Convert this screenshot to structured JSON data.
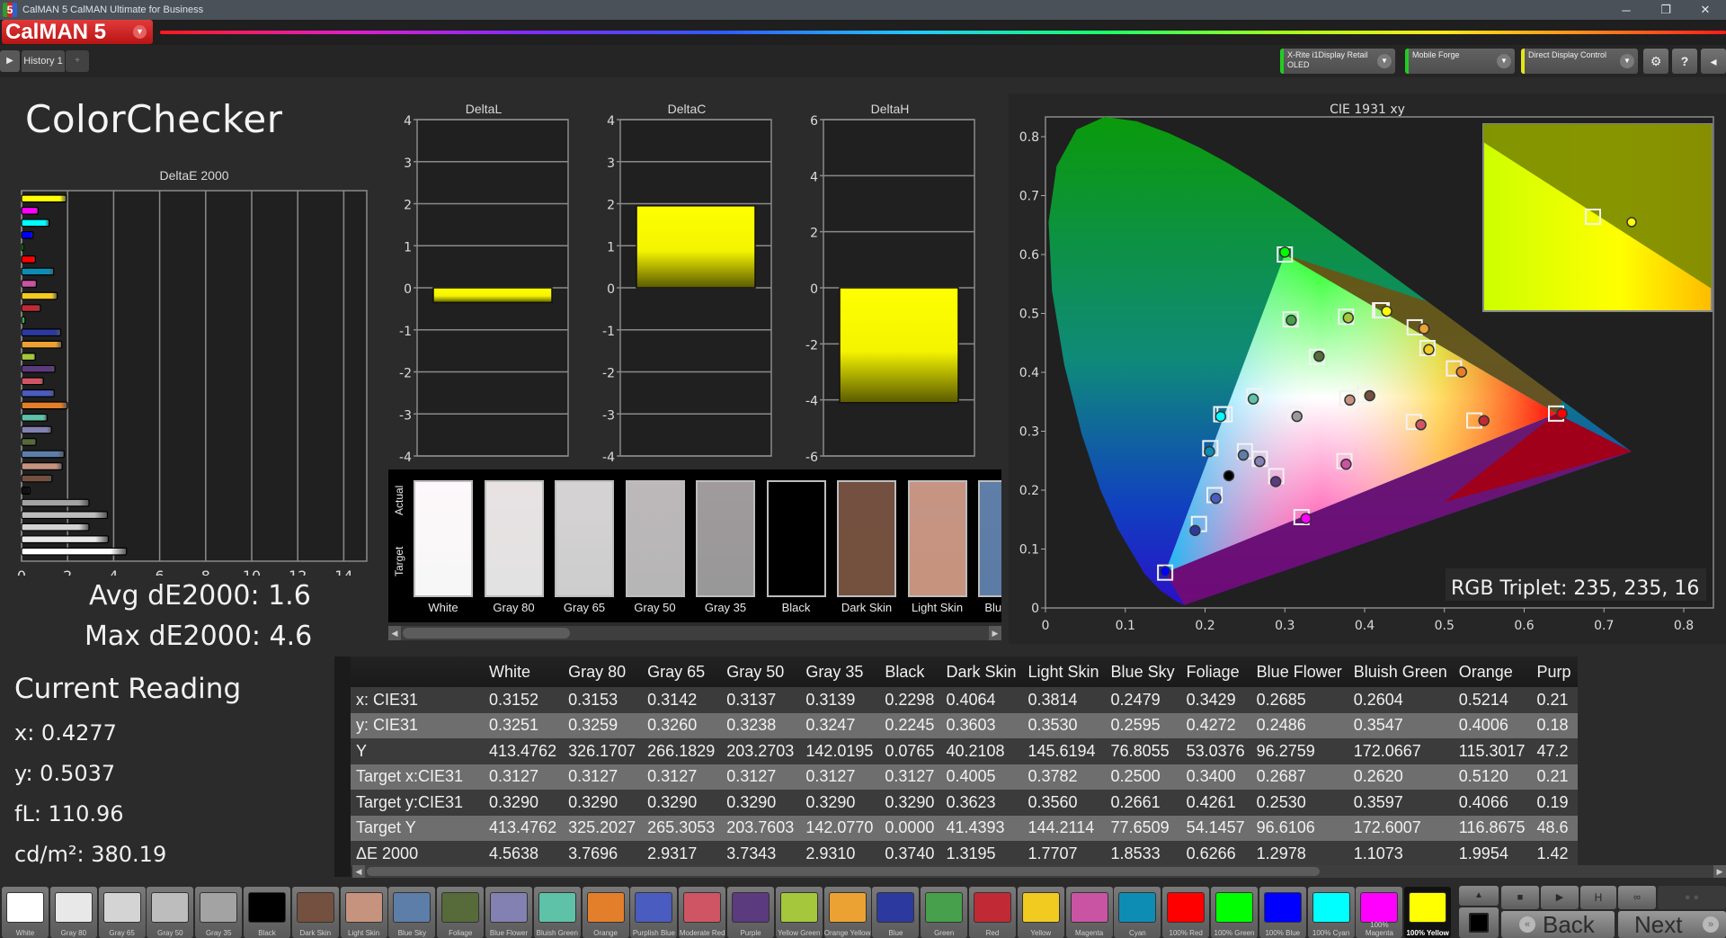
{
  "window": {
    "title": "CalMAN 5 CalMAN Ultimate for Business",
    "app_icon": "5",
    "controls": [
      "minimize-icon",
      "restore-icon",
      "close-icon"
    ]
  },
  "brand": {
    "label": "CalMAN 5",
    "dropdown_icon": "chevron-down-icon"
  },
  "toolbar": {
    "play_icon": "play-icon",
    "history_tab": "History 1",
    "add_tab_icon": "plus-icon",
    "devices": [
      {
        "line1": "X-Rite i1Display Retail",
        "line2": "OLED",
        "status_color": "#22cc22"
      },
      {
        "line1": "Mobile Forge",
        "line2": "",
        "status_color": "#22cc22"
      },
      {
        "line1": "Direct Display Control",
        "line2": "",
        "status_color": "#e5e51a"
      }
    ],
    "buttons": [
      {
        "icon": "gear-icon",
        "glyph": "⚙"
      },
      {
        "icon": "help-icon",
        "glyph": "?"
      },
      {
        "icon": "collapse-icon",
        "glyph": "◂"
      }
    ]
  },
  "page": {
    "title": "ColorChecker"
  },
  "summary": {
    "avg": "Avg dE2000: 1.6",
    "max": "Max dE2000: 4.6"
  },
  "current_reading": {
    "title": "Current Reading",
    "x": "x: 0.4277",
    "y": "y: 0.5037",
    "fl": "fL: 110.96",
    "cdm2": "cd/m²: 380.19"
  },
  "swatch_strip": {
    "actual_label": "Actual",
    "target_label": "Target",
    "items": [
      {
        "name": "White",
        "actual": "#fdf8fb",
        "target": "#f7f7f7"
      },
      {
        "name": "Gray 80",
        "actual": "#e8e2e3",
        "target": "#e2e2e2"
      },
      {
        "name": "Gray 65",
        "actual": "#d6d3d4",
        "target": "#cdcdcd"
      },
      {
        "name": "Gray 50",
        "actual": "#bdb8ba",
        "target": "#b6b6b6"
      },
      {
        "name": "Gray 35",
        "actual": "#a09a9c",
        "target": "#989898"
      },
      {
        "name": "Black",
        "actual": "#000000",
        "target": "#000000"
      },
      {
        "name": "Dark Skin",
        "actual": "#73503f",
        "target": "#74503f"
      },
      {
        "name": "Light Skin",
        "actual": "#c79483",
        "target": "#c5937e"
      },
      {
        "name": "Blue Sky",
        "actual": "#5f7ea8",
        "target": "#5b7ca6"
      }
    ]
  },
  "table": {
    "columns": [
      "White",
      "Gray 80",
      "Gray 65",
      "Gray 50",
      "Gray 35",
      "Black",
      "Dark Skin",
      "Light Skin",
      "Blue Sky",
      "Foliage",
      "Blue Flower",
      "Bluish Green",
      "Orange",
      "Purp"
    ],
    "rows": [
      {
        "label": "x: CIE31",
        "values": [
          "0.3152",
          "0.3153",
          "0.3142",
          "0.3137",
          "0.3139",
          "0.2298",
          "0.4064",
          "0.3814",
          "0.2479",
          "0.3429",
          "0.2685",
          "0.2604",
          "0.5214",
          "0.21"
        ]
      },
      {
        "label": "y: CIE31",
        "values": [
          "0.3251",
          "0.3259",
          "0.3260",
          "0.3238",
          "0.3247",
          "0.2245",
          "0.3603",
          "0.3530",
          "0.2595",
          "0.4272",
          "0.2486",
          "0.3547",
          "0.4006",
          "0.18"
        ]
      },
      {
        "label": "Y",
        "values": [
          "413.4762",
          "326.1707",
          "266.1829",
          "203.2703",
          "142.0195",
          "0.0765",
          "40.2108",
          "145.6194",
          "76.8055",
          "53.0376",
          "96.2759",
          "172.0667",
          "115.3017",
          "47.2"
        ]
      },
      {
        "label": "Target x:CIE31",
        "values": [
          "0.3127",
          "0.3127",
          "0.3127",
          "0.3127",
          "0.3127",
          "0.3127",
          "0.4005",
          "0.3782",
          "0.2500",
          "0.3400",
          "0.2687",
          "0.2620",
          "0.5120",
          "0.21"
        ]
      },
      {
        "label": "Target y:CIE31",
        "values": [
          "0.3290",
          "0.3290",
          "0.3290",
          "0.3290",
          "0.3290",
          "0.3290",
          "0.3623",
          "0.3560",
          "0.2661",
          "0.4261",
          "0.2530",
          "0.3597",
          "0.4066",
          "0.19"
        ]
      },
      {
        "label": "Target Y",
        "values": [
          "413.4762",
          "325.2027",
          "265.3053",
          "203.7603",
          "142.0770",
          "0.0000",
          "41.4393",
          "144.2114",
          "77.6509",
          "54.1457",
          "96.6106",
          "172.6007",
          "116.8675",
          "48.6"
        ]
      },
      {
        "label": "ΔE 2000",
        "values": [
          "4.5638",
          "3.7696",
          "2.9317",
          "3.7343",
          "2.9310",
          "0.3740",
          "1.3195",
          "1.7707",
          "1.8533",
          "0.6266",
          "1.2978",
          "1.1073",
          "1.9954",
          "1.42"
        ]
      }
    ]
  },
  "patches": [
    {
      "label": "White",
      "color": "#ffffff"
    },
    {
      "label": "Gray 80",
      "color": "#e8e8e8"
    },
    {
      "label": "Gray 65",
      "color": "#d4d4d4"
    },
    {
      "label": "Gray 50",
      "color": "#bdbdbd"
    },
    {
      "label": "Gray 35",
      "color": "#a3a3a3"
    },
    {
      "label": "Black",
      "color": "#000000"
    },
    {
      "label": "Dark Skin",
      "color": "#73503f"
    },
    {
      "label": "Light Skin",
      "color": "#c6937f"
    },
    {
      "label": "Blue Sky",
      "color": "#5c7ea8"
    },
    {
      "label": "Foliage",
      "color": "#566a3a"
    },
    {
      "label": "Blue Flower",
      "color": "#8381b2"
    },
    {
      "label": "Bluish Green",
      "color": "#5ec2a8"
    },
    {
      "label": "Orange",
      "color": "#e37f2a"
    },
    {
      "label": "Purplish Blue",
      "color": "#4a5cc0"
    },
    {
      "label": "Moderate Red",
      "color": "#d05564"
    },
    {
      "label": "Purple",
      "color": "#5b3a7e"
    },
    {
      "label": "Yellow Green",
      "color": "#a5c73c"
    },
    {
      "label": "Orange Yellow",
      "color": "#eca232"
    },
    {
      "label": "Blue",
      "color": "#2c3aa0"
    },
    {
      "label": "Green",
      "color": "#47a04b"
    },
    {
      "label": "Red",
      "color": "#c12a35"
    },
    {
      "label": "Yellow",
      "color": "#f1cb1f"
    },
    {
      "label": "Magenta",
      "color": "#c954a4"
    },
    {
      "label": "Cyan",
      "color": "#0e8db4"
    },
    {
      "label": "100% Red",
      "color": "#ff0000"
    },
    {
      "label": "100% Green",
      "color": "#00ff00"
    },
    {
      "label": "100% Blue",
      "color": "#0000ff"
    },
    {
      "label": "100% Cyan",
      "color": "#00ffff"
    },
    {
      "label": "100% Magenta",
      "color": "#ff00ff"
    },
    {
      "label": "100% Yellow",
      "color": "#ffff00",
      "selected": true
    }
  ],
  "controls": {
    "up_icon": "eject-icon",
    "stop_small_icon": "stop-icon",
    "stop_icon": "stop-square-icon",
    "play_icon": "play-icon",
    "hold_icon": "hold-icon",
    "loop_icon": "loop-icon",
    "back_label": "Back",
    "next_label": "Next"
  },
  "cie": {
    "rgb_triplet": "RGB Triplet: 235, 235, 16"
  },
  "chart_data": [
    {
      "type": "bar",
      "orientation": "horizontal",
      "title": "DeltaE 2000",
      "xlim": [
        0,
        15
      ],
      "xticks": [
        0,
        2,
        4,
        6,
        8,
        10,
        12,
        14
      ],
      "grid": true,
      "categories": [
        "White",
        "Gray 80",
        "Gray 65",
        "Gray 50",
        "Gray 35",
        "Black",
        "Dark Skin",
        "Light Skin",
        "Blue Sky",
        "Foliage",
        "Blue Flower",
        "Bluish Green",
        "Orange",
        "Purplish Blue",
        "Moderate Red",
        "Purple",
        "Yellow Green",
        "Orange Yellow",
        "Blue",
        "Green",
        "Red",
        "Yellow",
        "Magenta",
        "Cyan",
        "100% Red",
        "100% Green",
        "100% Blue",
        "100% Cyan",
        "100% Magenta",
        "100% Yellow"
      ],
      "values": [
        4.56,
        3.77,
        2.93,
        3.73,
        2.93,
        0.37,
        1.32,
        1.77,
        1.85,
        0.63,
        1.3,
        1.11,
        1.99,
        1.42,
        0.95,
        1.45,
        0.6,
        1.75,
        1.7,
        0.15,
        0.82,
        1.55,
        0.65,
        1.4,
        0.6,
        0.05,
        0.5,
        1.2,
        0.72,
        1.95
      ],
      "colors": [
        "#ffffff",
        "#e8e8e8",
        "#d4d4d4",
        "#bdbdbd",
        "#a3a3a3",
        "#111111",
        "#73503f",
        "#c6937f",
        "#5c7ea8",
        "#566a3a",
        "#8381b2",
        "#5ec2a8",
        "#e37f2a",
        "#4a5cc0",
        "#d05564",
        "#5b3a7e",
        "#a5c73c",
        "#eca232",
        "#2c3aa0",
        "#47a04b",
        "#c12a35",
        "#f1cb1f",
        "#c954a4",
        "#0e8db4",
        "#ff0000",
        "#00ff00",
        "#0000ff",
        "#00ffff",
        "#ff00ff",
        "#ffff00"
      ]
    },
    {
      "type": "bar",
      "title": "DeltaL",
      "ylim": [
        -4,
        4
      ],
      "yticks": [
        -4,
        -3,
        -2,
        -1,
        0,
        1,
        2,
        3,
        4
      ],
      "values": [
        -0.35
      ],
      "color": "#ffff00"
    },
    {
      "type": "bar",
      "title": "DeltaC",
      "ylim": [
        -4,
        4
      ],
      "yticks": [
        -4,
        -3,
        -2,
        -1,
        0,
        1,
        2,
        3,
        4
      ],
      "values": [
        1.95
      ],
      "color": "#ffff00"
    },
    {
      "type": "bar",
      "title": "DeltaH",
      "ylim": [
        -6,
        6
      ],
      "yticks": [
        -6,
        -4,
        -2,
        0,
        2,
        4,
        6
      ],
      "values": [
        -4.1
      ],
      "color": "#ffff00"
    },
    {
      "type": "scatter",
      "title": "CIE 1931 xy",
      "xlim": [
        0,
        0.84
      ],
      "ylim": [
        0,
        0.84
      ],
      "xticks": [
        0,
        0.1,
        0.2,
        0.3,
        0.4,
        0.5,
        0.6,
        0.7,
        0.8
      ],
      "yticks": [
        0,
        0.1,
        0.2,
        0.3,
        0.4,
        0.5,
        0.6,
        0.7,
        0.8
      ],
      "gamut_triangle": {
        "red": [
          0.64,
          0.33
        ],
        "green": [
          0.3,
          0.6
        ],
        "blue": [
          0.15,
          0.06
        ]
      },
      "targets": [
        {
          "x": 0.3127,
          "y": 0.329
        },
        {
          "x": 0.4005,
          "y": 0.3623
        },
        {
          "x": 0.3782,
          "y": 0.356
        },
        {
          "x": 0.25,
          "y": 0.2661
        },
        {
          "x": 0.34,
          "y": 0.4261
        },
        {
          "x": 0.2687,
          "y": 0.253
        },
        {
          "x": 0.262,
          "y": 0.3597
        },
        {
          "x": 0.512,
          "y": 0.4066
        },
        {
          "x": 0.2119,
          "y": 0.1916
        },
        {
          "x": 0.4617,
          "y": 0.3158
        },
        {
          "x": 0.2892,
          "y": 0.2238
        },
        {
          "x": 0.3767,
          "y": 0.4943
        },
        {
          "x": 0.4628,
          "y": 0.4764
        },
        {
          "x": 0.1924,
          "y": 0.1425
        },
        {
          "x": 0.3072,
          "y": 0.4899
        },
        {
          "x": 0.5375,
          "y": 0.3182
        },
        {
          "x": 0.4214,
          "y": 0.5053
        },
        {
          "x": 0.3747,
          "y": 0.2493
        },
        {
          "x": 0.2203,
          "y": 0.3289
        },
        {
          "x": 0.64,
          "y": 0.33
        },
        {
          "x": 0.3,
          "y": 0.6
        },
        {
          "x": 0.15,
          "y": 0.06
        },
        {
          "x": 0.2246,
          "y": 0.3287
        },
        {
          "x": 0.3209,
          "y": 0.1542
        },
        {
          "x": 0.4193,
          "y": 0.5053
        },
        {
          "x": 0.2066,
          "y": 0.2712
        },
        {
          "x": 0.4788,
          "y": 0.4412
        }
      ],
      "actuals": [
        {
          "x": 0.3152,
          "y": 0.3251,
          "c": "#9a9a9a"
        },
        {
          "x": 0.4064,
          "y": 0.3603,
          "c": "#73503f"
        },
        {
          "x": 0.3814,
          "y": 0.353,
          "c": "#c6937f"
        },
        {
          "x": 0.2479,
          "y": 0.2595,
          "c": "#5c7ea8"
        },
        {
          "x": 0.3429,
          "y": 0.4272,
          "c": "#566a3a"
        },
        {
          "x": 0.2685,
          "y": 0.2486,
          "c": "#8381b2"
        },
        {
          "x": 0.2604,
          "y": 0.3547,
          "c": "#5ec2a8"
        },
        {
          "x": 0.5214,
          "y": 0.4006,
          "c": "#e37f2a"
        },
        {
          "x": 0.2298,
          "y": 0.2245,
          "c": "#000000"
        },
        {
          "x": 0.2135,
          "y": 0.186,
          "c": "#4a5cc0"
        },
        {
          "x": 0.4705,
          "y": 0.311,
          "c": "#d05564"
        },
        {
          "x": 0.2886,
          "y": 0.2145,
          "c": "#5b3a7e"
        },
        {
          "x": 0.3795,
          "y": 0.4925,
          "c": "#a5c73c"
        },
        {
          "x": 0.4745,
          "y": 0.474,
          "c": "#eca232"
        },
        {
          "x": 0.1875,
          "y": 0.1315,
          "c": "#2c3aa0"
        },
        {
          "x": 0.3081,
          "y": 0.4885,
          "c": "#47a04b"
        },
        {
          "x": 0.5495,
          "y": 0.318,
          "c": "#c12a35"
        },
        {
          "x": 0.4277,
          "y": 0.5037,
          "c": "#ffff00"
        },
        {
          "x": 0.3768,
          "y": 0.244,
          "c": "#c954a4"
        },
        {
          "x": 0.2195,
          "y": 0.325,
          "c": "#00ffff"
        },
        {
          "x": 0.6475,
          "y": 0.33,
          "c": "#ff0000"
        },
        {
          "x": 0.3,
          "y": 0.604,
          "c": "#00ff00"
        },
        {
          "x": 0.15,
          "y": 0.062,
          "c": "#0000ff"
        },
        {
          "x": 0.3265,
          "y": 0.152,
          "c": "#ff00ff"
        },
        {
          "x": 0.2055,
          "y": 0.2655,
          "c": "#0e8db4"
        },
        {
          "x": 0.4805,
          "y": 0.4385,
          "c": "#f1cb1f"
        }
      ],
      "annotation": "RGB Triplet: 235, 235, 16"
    }
  ]
}
